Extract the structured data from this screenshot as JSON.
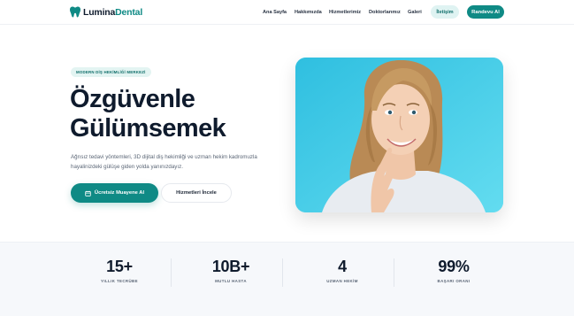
{
  "brand": {
    "name_part1": "Lumina",
    "name_part2": "Dental",
    "accent_color": "#0f8a85"
  },
  "nav": {
    "items": [
      {
        "label": "Ana Sayfa"
      },
      {
        "label": "Hakkımızda"
      },
      {
        "label": "Hizmetlerimiz"
      },
      {
        "label": "Doktorlarımız"
      },
      {
        "label": "Galeri"
      }
    ],
    "contact_label": "İletişim",
    "appointment_label": "Randevu Al"
  },
  "hero": {
    "badge": "MODERN DİŞ HEKİMLİĞİ MERKEZİ",
    "title_line1": "Özgüvenle",
    "title_line2": "Gülümsemek",
    "description": "Ağrısız tedavi yöntemleri, 3D dijital diş hekimliği ve uzman hekim kadromuzla hayalinizdeki gülüşe giden yolda yanınızdayız.",
    "primary_button": "Ücretsiz Muayene Al",
    "secondary_button": "Hizmetleri İncele"
  },
  "stats": [
    {
      "value": "15+",
      "label": "YILLIK TECRÜBE"
    },
    {
      "value": "10B+",
      "label": "MUTLU HASTA"
    },
    {
      "value": "4",
      "label": "UZMAN HEKİM"
    },
    {
      "value": "99%",
      "label": "BAŞARI ORANI"
    }
  ]
}
